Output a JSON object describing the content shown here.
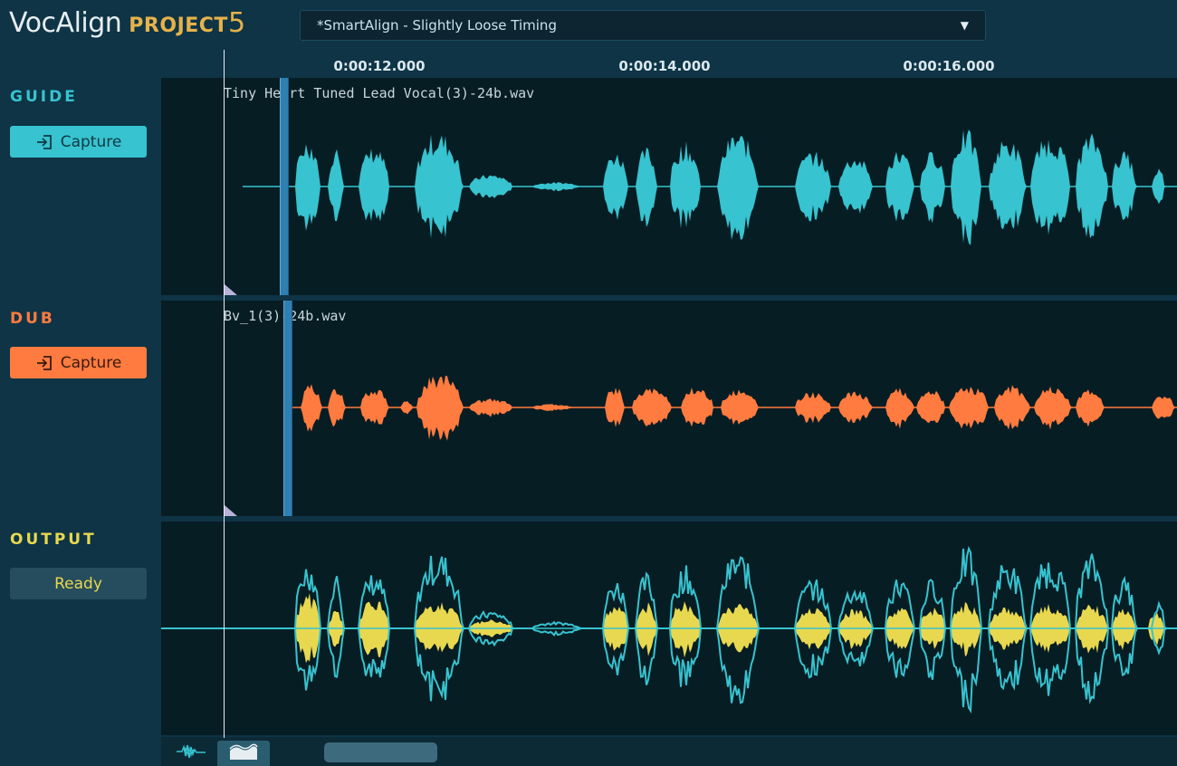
{
  "app": {
    "name": "VocAlign",
    "edition": "PROJECT",
    "version": "5"
  },
  "preset": {
    "selected": "*SmartAlign - Slightly Loose Timing",
    "arrow_icon": "dropdown-arrow-icon"
  },
  "ruler": {
    "ticks": [
      "0:00:12.000",
      "0:00:14.000",
      "0:00:16.000"
    ]
  },
  "guide": {
    "label": "GUIDE",
    "button": "Capture",
    "file": "Tiny Heart Tuned Lead Vocal(3)-24b.wav",
    "color": "#37c3cf",
    "label_color": "#37c3cf"
  },
  "dub": {
    "label": "DUB",
    "button": "Capture",
    "file": "Bv_1(3)-24b.wav",
    "color": "#ff7b3f",
    "label_color": "#ff7b3f"
  },
  "output": {
    "label": "OUTPUT",
    "button": "Ready",
    "color": "#e8d84f",
    "outline_color": "#37c3cf",
    "label_color": "#e8d84f"
  },
  "icons": {
    "capture": "capture-icon",
    "waveform_view": "waveform-view-icon",
    "overlay_view": "overlay-view-icon"
  }
}
